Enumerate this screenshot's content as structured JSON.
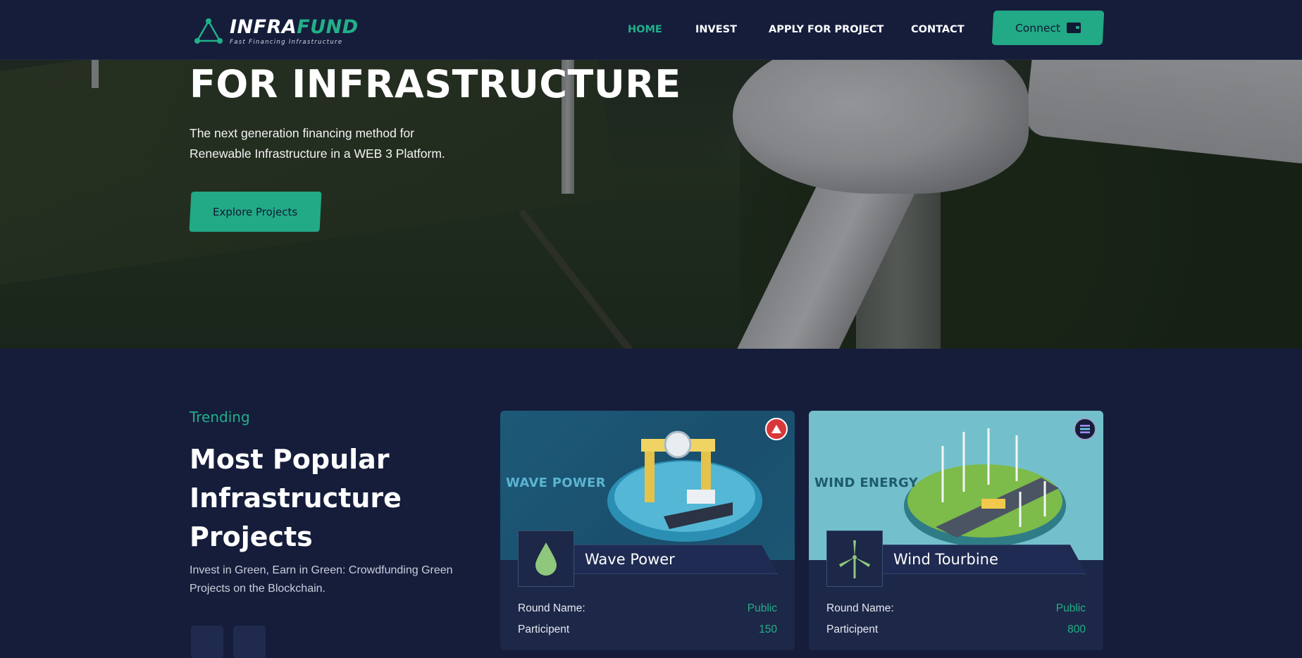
{
  "brand": {
    "name_part1": "INFRA",
    "name_part2": "FUND",
    "tagline": "Fast Financing Infrastructure",
    "accent": "#22b088",
    "background": "#151d3b"
  },
  "nav": {
    "items": [
      {
        "label": "HOME",
        "active": true
      },
      {
        "label": "INVEST",
        "active": false
      },
      {
        "label": "APPLY FOR PROJECT",
        "active": false
      },
      {
        "label": "CONTACT",
        "active": false
      }
    ],
    "connect_label": "Connect",
    "connect_icon": "wallet-icon"
  },
  "hero": {
    "title": "FOR INFRASTRUCTURE",
    "subtitle_line1": "The next generation financing method for",
    "subtitle_line2": "Renewable Infrastructure in a WEB 3 Platform.",
    "cta_label": "Explore Projects"
  },
  "trending": {
    "label": "Trending",
    "title_line1": "Most Popular",
    "title_line2": "Infrastructure",
    "title_line3": "Projects",
    "description": "Invest in Green, Earn in Green: Crowdfunding Green Projects on the Blockchain."
  },
  "cards": [
    {
      "image_label": "WAVE POWER",
      "name": "Wave Power",
      "icon": "water-drop-icon",
      "chain_icon": "avalanche-icon",
      "rows": [
        {
          "key": "Round Name:",
          "value": "Public"
        },
        {
          "key": "Participent",
          "value": "150"
        }
      ]
    },
    {
      "image_label": "WIND ENERGY",
      "name": "Wind Tourbine",
      "icon": "wind-turbine-icon",
      "chain_icon": "solana-icon",
      "rows": [
        {
          "key": "Round Name:",
          "value": "Public"
        },
        {
          "key": "Participent",
          "value": "800"
        }
      ]
    }
  ]
}
